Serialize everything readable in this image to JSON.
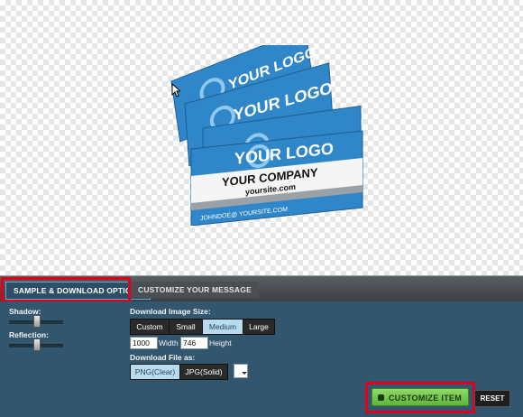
{
  "preview": {
    "card_logo_text": "YOUR LOGO",
    "company_text": "YOUR COMPANY",
    "site_text": "yoursite.com",
    "email_text": "JOHNDOE@ YOURSITE.COM"
  },
  "tabs": [
    {
      "label": "SAMPLE & DOWNLOAD OPTIONS",
      "active": true
    },
    {
      "label": "CUSTOMIZE YOUR MESSAGE",
      "active": false
    }
  ],
  "options": {
    "shadow_label": "Shadow:",
    "shadow_value": 0.5,
    "reflection_label": "Reflection:",
    "reflection_value": 0.5,
    "download_size_label": "Download Image Size:",
    "sizes": [
      "Custom",
      "Small",
      "Medium",
      "Large"
    ],
    "selected_size": "Medium",
    "width_value": "1000",
    "width_label": "Width",
    "height_value": "746",
    "height_label": "Height",
    "file_as_label": "Download File as:",
    "formats": [
      "PNG(Clear)",
      "JPG(Solid)"
    ],
    "selected_format": "PNG(Clear)"
  },
  "actions": {
    "customize_label": "CUSTOMIZE ITEM",
    "reset_label": "RESET"
  },
  "colors": {
    "card_blue": "#2f86c8",
    "panel_bg": "#32566d",
    "highlight_red": "#e0001b",
    "customize_green": "#7ccb55"
  }
}
